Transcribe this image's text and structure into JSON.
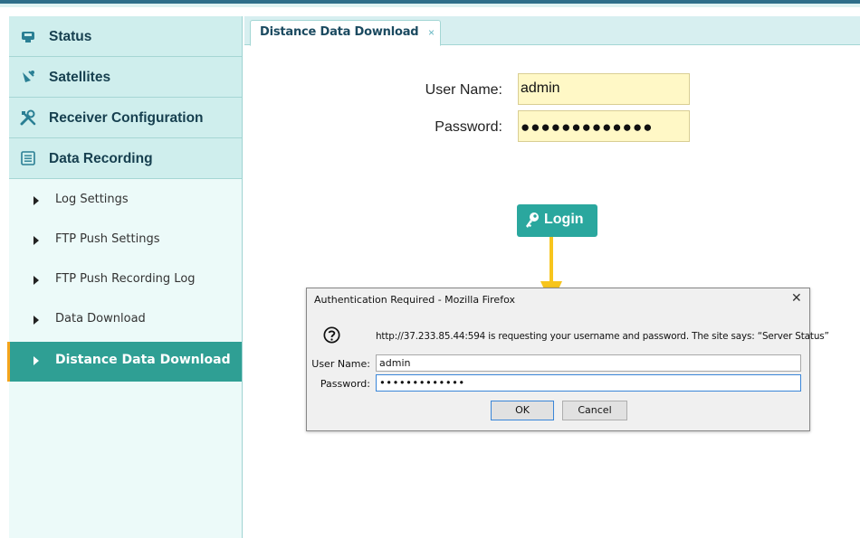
{
  "sidebar": {
    "sections": [
      {
        "label": "Status",
        "icon": "receiver-icon"
      },
      {
        "label": "Satellites",
        "icon": "satellite-icon"
      },
      {
        "label": "Receiver Configuration",
        "icon": "tools-icon"
      },
      {
        "label": "Data Recording",
        "icon": "list-icon"
      }
    ],
    "items": [
      {
        "label": "Log Settings"
      },
      {
        "label": "FTP Push Settings"
      },
      {
        "label": "FTP Push Recording Log"
      },
      {
        "label": "Data Download"
      },
      {
        "label": "Distance Data Download",
        "active": true
      }
    ]
  },
  "tabs": [
    {
      "label": "Distance Data Download",
      "close": "×"
    }
  ],
  "form": {
    "username_label": "User Name:",
    "username_value": "admin",
    "password_label": "Password:",
    "password_value": "●●●●●●●●●●●●●",
    "login_label": "Login"
  },
  "dialog": {
    "title": "Authentication Required - Mozilla Firefox",
    "close": "✕",
    "message": "http://37.233.85.44:594 is requesting your username and password. The site says: “Server Status”",
    "username_label": "User Name:",
    "username_value": "admin",
    "password_label": "Password:",
    "password_value": "•••••••••••••",
    "ok_label": "OK",
    "cancel_label": "Cancel"
  },
  "colors": {
    "accent": "#2aa79e",
    "active_marker": "#f5a41c",
    "arrow": "#f7c51d",
    "field_bg": "#fff8c6"
  }
}
